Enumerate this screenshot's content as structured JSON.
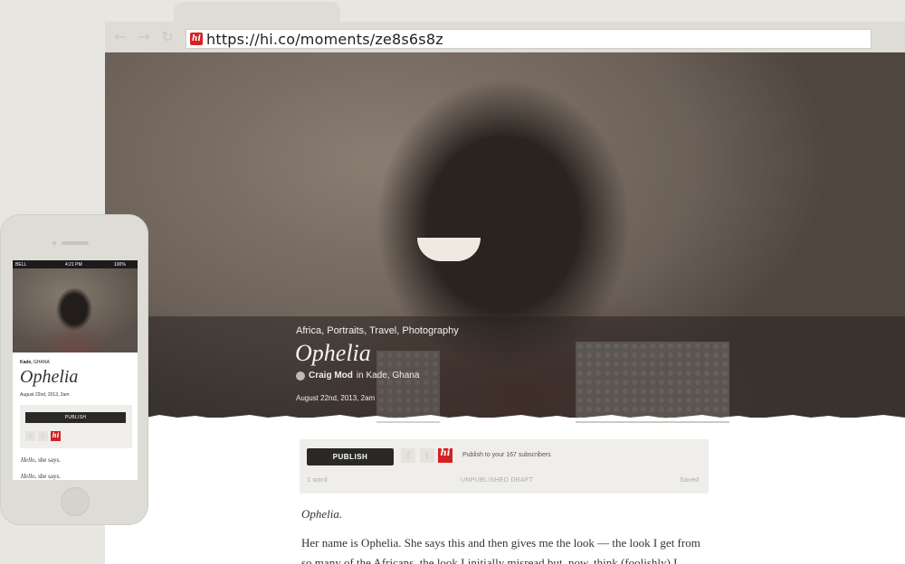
{
  "browser": {
    "url": "https://hi.co/moments/ze8s6s8z",
    "back_icon": "back-arrow-icon",
    "forward_icon": "forward-arrow-icon",
    "reload_icon": "reload-icon",
    "favicon_text": "hi"
  },
  "moment": {
    "tags": "Africa, Portraits, Travel, Photography",
    "title": "Ophelia",
    "author": "Craig Mod",
    "location_text": "in Kade, Ghana",
    "date": "August 22nd, 2013, 2am"
  },
  "editor": {
    "publish_label": "PUBLISH",
    "publish_note": "Publish to your 167 subscribers",
    "word_count": "1 word",
    "status": "UNPUBLISHED DRAFT",
    "save_state": "Saved",
    "share_icons": [
      "facebook-icon",
      "twitter-icon",
      "hi-icon"
    ],
    "hi_text": "hi"
  },
  "body": {
    "p1": "Ophelia.",
    "p2": "Her name is Ophelia. She says this and then gives me the look — the look I get from so many of the Africans, the look I initially misread but, now, think (foolishly) I"
  },
  "phone": {
    "carrier": "BELL",
    "time": "4:21 PM",
    "battery": "100%",
    "location_city": "Kade,",
    "location_country": "GHANA",
    "title": "Ophelia",
    "date": "August 22nd, 2013, 2am",
    "publish_label": "PUBLISH",
    "line1_italic": "Hello,",
    "line1_rest": " she says.",
    "line2_italic": "Hello,",
    "line2_rest": " she says."
  },
  "colors": {
    "brand_red": "#d32222",
    "publish_button": "#2a2927",
    "background": "#e7e6e1"
  }
}
